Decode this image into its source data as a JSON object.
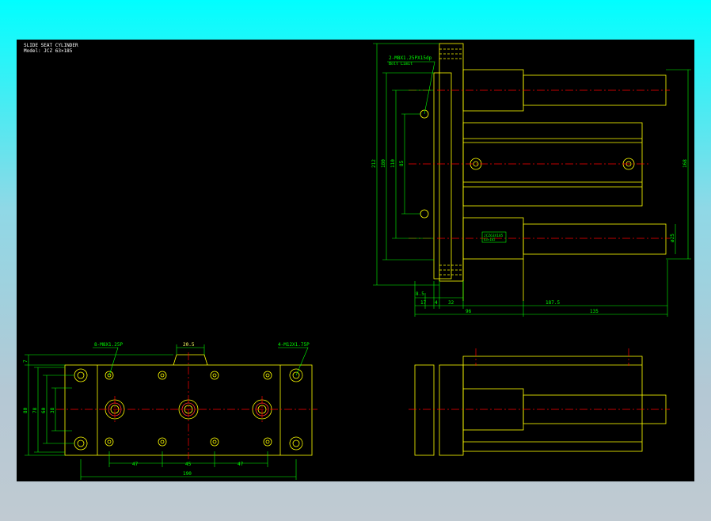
{
  "drawing": {
    "title": "SLIDE SEAT CYLINDER",
    "model": "Model: JCZ 63×185"
  },
  "colors": {
    "outline": "#ffff00",
    "dimension": "#00ff00",
    "center_line": "#ff0000",
    "canvas": "#000000"
  },
  "side_view": {
    "callout_thread": "2-M8X1.25PX15dp",
    "callout_note": "Bolt Limit",
    "label_tag": "JCZ63X185",
    "label_sub": "63×185",
    "dims": {
      "h212": "212",
      "h180": "180",
      "h110": "110",
      "h85": "85",
      "h168": "168",
      "d25": "ø25",
      "w8_5": "8.5",
      "w17": "17",
      "w4": "4",
      "w32": "32",
      "w187_5": "187.5",
      "w96": "96",
      "w135": "135"
    }
  },
  "front_view": {
    "callout_left": "8-M8X1.25P",
    "callout_right": "4-M12X1.75P",
    "dims": {
      "top_20_5": "20.5",
      "h7": "7",
      "h80": "80",
      "h78": "78",
      "h60": "60",
      "h38": "38",
      "w47a": "47",
      "w45": "45",
      "w47b": "47",
      "w190": "190"
    }
  }
}
